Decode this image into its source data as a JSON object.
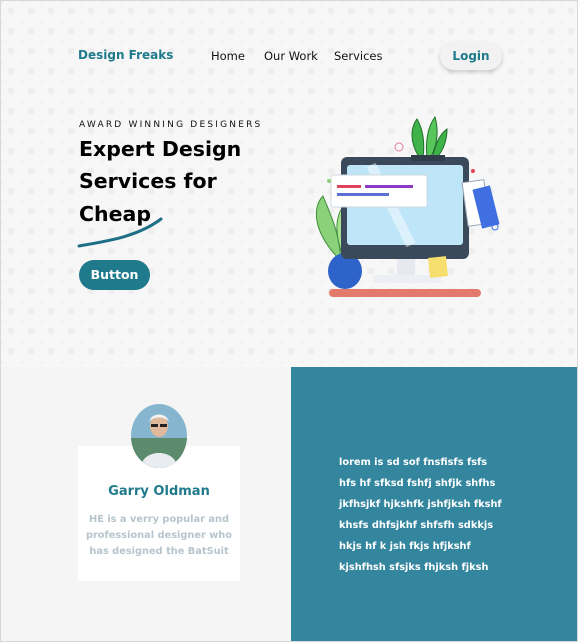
{
  "header": {
    "brand": "Design Freaks",
    "nav": [
      "Home",
      "Our Work",
      "Services"
    ],
    "login_label": "Login"
  },
  "hero": {
    "kicker": "AWARD WINNING DESIGNERS",
    "headline": [
      "Expert Design",
      "Services for",
      "Cheap"
    ],
    "cta_label": "Button",
    "illustration_icon": "computer-illustration-icon"
  },
  "profile": {
    "name": "Garry Oldman",
    "bio": [
      "HE is a verry popular and",
      "professional  designer who",
      "has designed the BatSuit"
    ],
    "avatar_icon": "person-photo"
  },
  "panel": {
    "lines": [
      "lorem is sd sof  fnsfisfs fsfs",
      "hfs hf  sfksd fshfj shfjk shfhs",
      "jkfhsjkf hjkshfk jshfjksh fkshf",
      "khsfs dhfsjkhf shfsfh sdkkjs",
      "hkjs hf k jsh  fkjs  hfjkshf",
      "kjshfhsh sfsjks fhjksh fjksh"
    ]
  },
  "colors": {
    "accent": "#1f7a8c",
    "panel_bg": "#34869f",
    "muted_text": "#b7c5cc"
  }
}
